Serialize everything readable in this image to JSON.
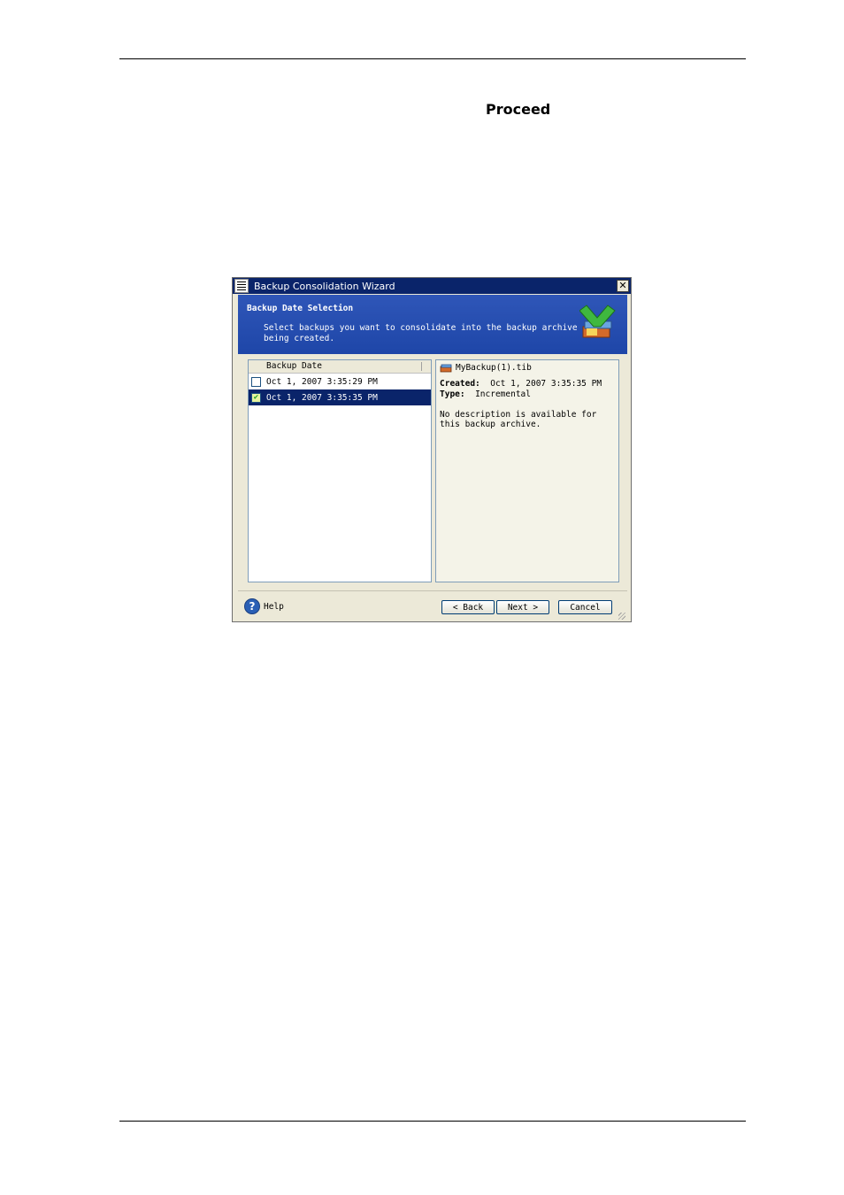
{
  "page": {
    "heading": "Proceed"
  },
  "dialog": {
    "title": "Backup Consolidation Wizard",
    "banner": {
      "title": "Backup Date Selection",
      "description": "Select backups you want to consolidate into the backup archive being created."
    },
    "list": {
      "column_header": "Backup Date",
      "items": [
        {
          "label": "Oct 1, 2007 3:35:29 PM",
          "checked": false,
          "selected": false
        },
        {
          "label": "Oct 1, 2007 3:35:35 PM",
          "checked": true,
          "selected": true
        }
      ]
    },
    "info": {
      "file_name": "MyBackup(1).tib",
      "created_label": "Created:",
      "created_value": "Oct 1, 2007 3:35:35 PM",
      "type_label": "Type:",
      "type_value": "Incremental",
      "description": "No description is available for this backup archive."
    },
    "footer": {
      "help_label": "Help",
      "back_label": "< Back",
      "next_label": "Next >",
      "cancel_label": "Cancel"
    }
  }
}
